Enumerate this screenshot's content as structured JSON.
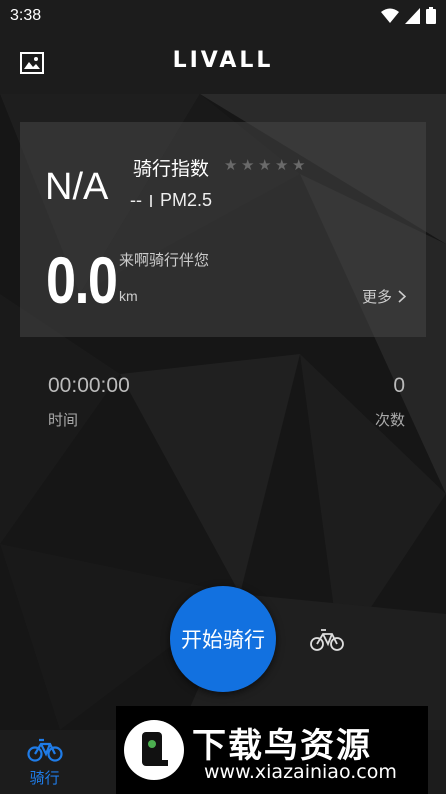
{
  "status_bar": {
    "time": "3:38"
  },
  "app_bar": {
    "logo_text": "LIVALL"
  },
  "weather_card": {
    "aqi_value": "N/A",
    "riding_index_label": "骑行指数",
    "riding_index_stars": 0,
    "riding_index_max_stars": 5,
    "pm_value": "--",
    "pm_label": "PM2.5"
  },
  "distance_card": {
    "distance": "0.0",
    "slogan": "来啊骑行伴您",
    "unit": "km",
    "more_label": "更多"
  },
  "stats": {
    "time_value": "00:00:00",
    "time_label": "时间",
    "count_value": "0",
    "count_label": "次数"
  },
  "start_button": {
    "label": "开始骑行"
  },
  "bottom_nav": {
    "active_color": "#1f7ce8",
    "items": [
      {
        "label": "骑行",
        "icon": "bicycle-icon",
        "active": true
      },
      {
        "label": "",
        "icon": "unknown-icon",
        "active": false
      },
      {
        "label": "",
        "icon": "unknown-icon",
        "active": false
      },
      {
        "label": "",
        "icon": "unknown-icon",
        "active": false
      },
      {
        "label": "",
        "icon": "unknown-icon",
        "active": false
      }
    ]
  },
  "watermark": {
    "title": "下载鸟资源",
    "url": "www.xiazainiao.com"
  },
  "colors": {
    "accent": "#1271e0",
    "background": "#1c1c1c"
  }
}
